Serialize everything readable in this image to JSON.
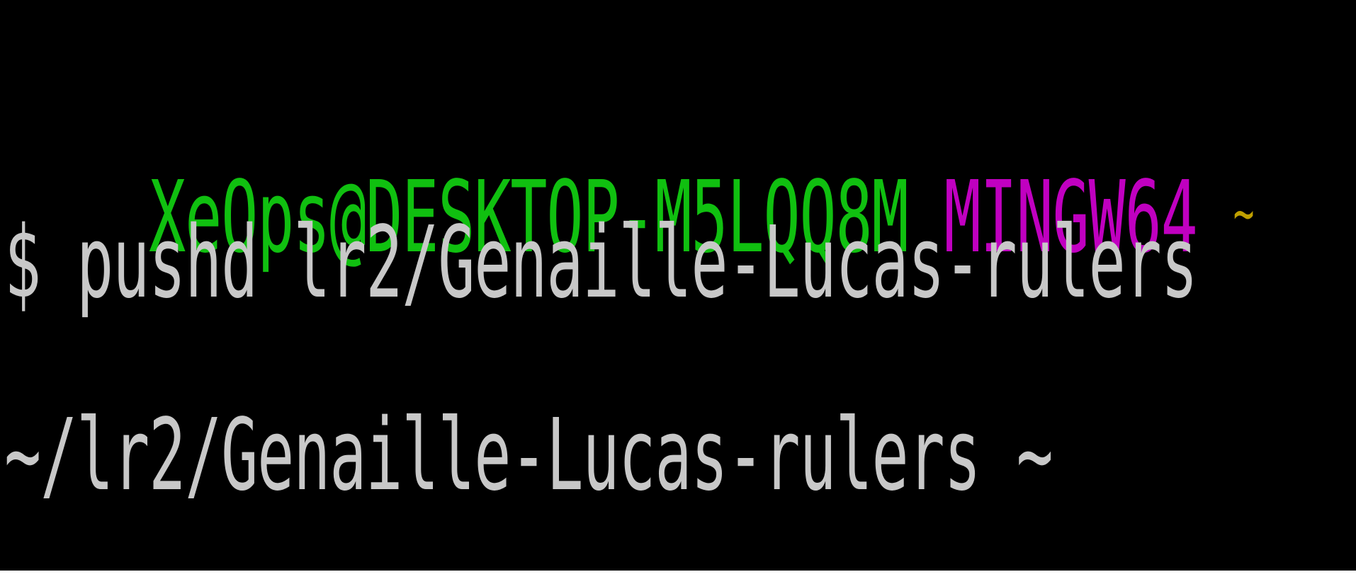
{
  "terminal": {
    "prompt": {
      "user_host": "XeOps@DESKTOP-M5LQQ8M",
      "env": "MINGW64",
      "cwd": "~"
    },
    "command_line": "$ pushd lr2/Genaille-Lucas-rulers",
    "output_line": "~/lr2/Genaille-Lucas-rulers ~"
  },
  "colors": {
    "background": "#000000",
    "user_host": "#10c010",
    "env": "#c000c0",
    "cwd": "#c0a000",
    "text": "#c8c8c8"
  }
}
